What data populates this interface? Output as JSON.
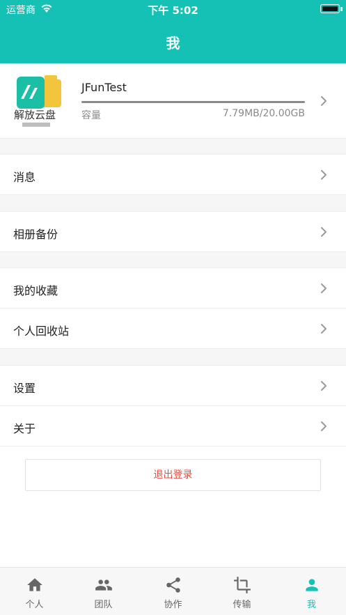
{
  "status_bar": {
    "carrier": "运营商",
    "time": "下午 5:02"
  },
  "header": {
    "title": "我"
  },
  "profile": {
    "username": "JFunTest",
    "capacity_label": "容量",
    "capacity_value": "7.79MB/20.00GB",
    "capacity_fraction": 0.0004,
    "logo_text": "解放云盘"
  },
  "menu": {
    "messages": "消息",
    "album_backup": "相册备份",
    "favorites": "我的收藏",
    "recycle_bin": "个人回收站",
    "settings": "设置",
    "about": "关于"
  },
  "logout": {
    "label": "退出登录"
  },
  "tabbar": {
    "items": [
      {
        "label": "个人",
        "icon": "home-icon"
      },
      {
        "label": "团队",
        "icon": "team-icon"
      },
      {
        "label": "协作",
        "icon": "share-icon"
      },
      {
        "label": "传输",
        "icon": "crop-transfer-icon"
      },
      {
        "label": "我",
        "icon": "person-icon"
      }
    ],
    "active_index": 4
  },
  "colors": {
    "accent": "#15c0b4",
    "logout": "#f24a3c",
    "logo_green": "#1bbfa6",
    "logo_yellow": "#f2c53d"
  }
}
